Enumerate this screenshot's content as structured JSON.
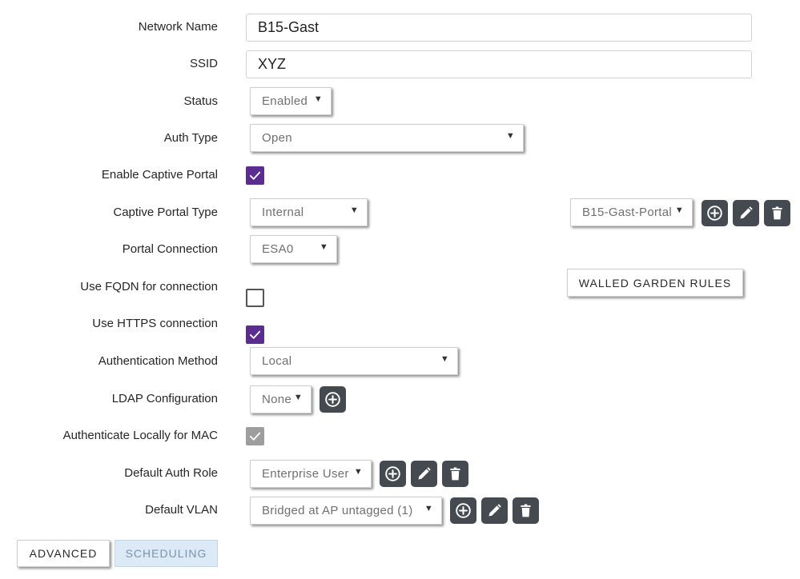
{
  "form": {
    "network_name": {
      "label": "Network Name",
      "value": "B15-Gast"
    },
    "ssid": {
      "label": "SSID",
      "value": "XYZ"
    },
    "status": {
      "label": "Status",
      "value": "Enabled"
    },
    "auth_type": {
      "label": "Auth Type",
      "value": "Open"
    },
    "enable_captive_portal": {
      "label": "Enable Captive Portal",
      "checked": true
    },
    "captive_portal_type": {
      "label": "Captive Portal Type",
      "value": "Internal",
      "portal_value": "B15-Gast-Portal"
    },
    "portal_connection": {
      "label": "Portal Connection",
      "value": "ESA0"
    },
    "use_fqdn": {
      "label": "Use FQDN for connection",
      "checked": false
    },
    "use_https": {
      "label": "Use HTTPS connection",
      "checked": true
    },
    "auth_method": {
      "label": "Authentication Method",
      "value": "Local"
    },
    "ldap_config": {
      "label": "LDAP Configuration",
      "value": "None"
    },
    "auth_locally_mac": {
      "label": "Authenticate Locally for MAC",
      "checked": true,
      "disabled": true
    },
    "default_auth_role": {
      "label": "Default Auth Role",
      "value": "Enterprise User"
    },
    "default_vlan": {
      "label": "Default VLAN",
      "value": "Bridged at AP untagged (1)"
    }
  },
  "buttons": {
    "walled_garden": "WALLED GARDEN RULES",
    "advanced": "ADVANCED",
    "scheduling": "SCHEDULING"
  },
  "icons": {
    "add": "plus-circle-icon",
    "edit": "pencil-icon",
    "delete": "trash-icon",
    "dropdown": "caret-down-icon",
    "check": "checkmark-icon"
  },
  "colors": {
    "checkbox_checked": "#5b2d91",
    "checkbox_disabled": "#9e9e9e",
    "icon_button": "#444a50",
    "tab_inactive_bg": "#dce9f6"
  }
}
